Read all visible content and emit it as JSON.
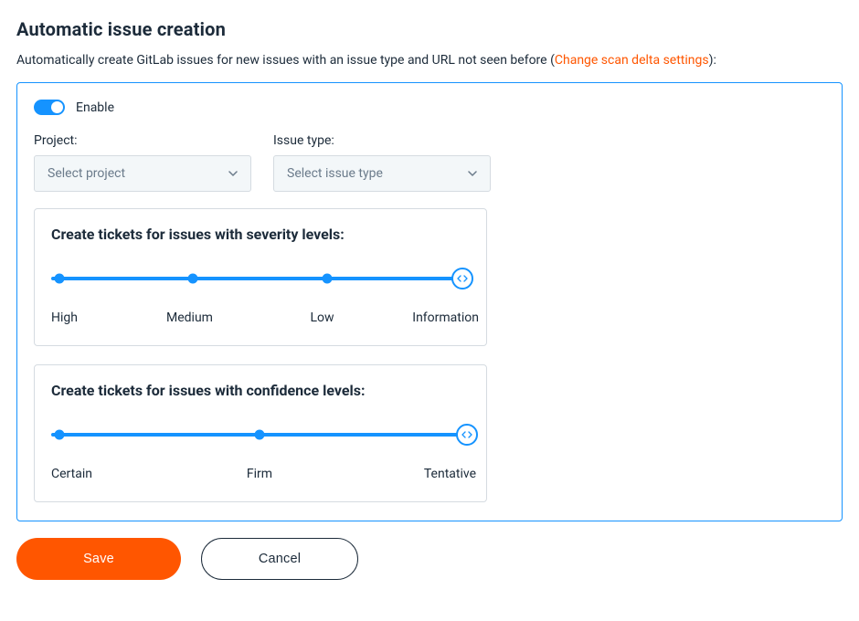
{
  "header": {
    "title": "Automatic issue creation",
    "intro_prefix": "Automatically create GitLab issues for new issues with an issue type and URL not seen before  (",
    "intro_link": "Change scan delta settings",
    "intro_suffix": "):"
  },
  "panel": {
    "enable_label": "Enable",
    "enable_on": true,
    "project": {
      "label": "Project:",
      "placeholder": "Select project"
    },
    "issue_type": {
      "label": "Issue type:",
      "placeholder": "Select issue type"
    },
    "severity": {
      "title": "Create tickets for issues with severity levels:",
      "levels": [
        "High",
        "Medium",
        "Low",
        "Information"
      ]
    },
    "confidence": {
      "title": "Create tickets for issues with confidence levels:",
      "levels": [
        "Certain",
        "Firm",
        "Tentative"
      ]
    }
  },
  "actions": {
    "save": "Save",
    "cancel": "Cancel"
  },
  "colors": {
    "accent": "#1593ff",
    "primary_button": "#ff5600"
  }
}
